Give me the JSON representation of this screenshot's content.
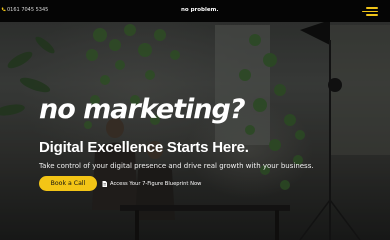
{
  "header": {
    "phone": "0161 7045 5345",
    "brand": "no problem."
  },
  "hero": {
    "headline": "no marketing?",
    "subheadline": "Digital Excellence Starts Here.",
    "tagline": "Take control of your digital presence and drive real growth with your business.",
    "primary_cta": "Book a Call",
    "secondary_cta": "Access Your 7-Figure Blueprint Now"
  },
  "colors": {
    "accent": "#f3c516",
    "topbar": "#050505"
  },
  "icons": {
    "menu": "hamburger-menu-icon",
    "phone": "phone-icon",
    "document": "document-icon"
  }
}
